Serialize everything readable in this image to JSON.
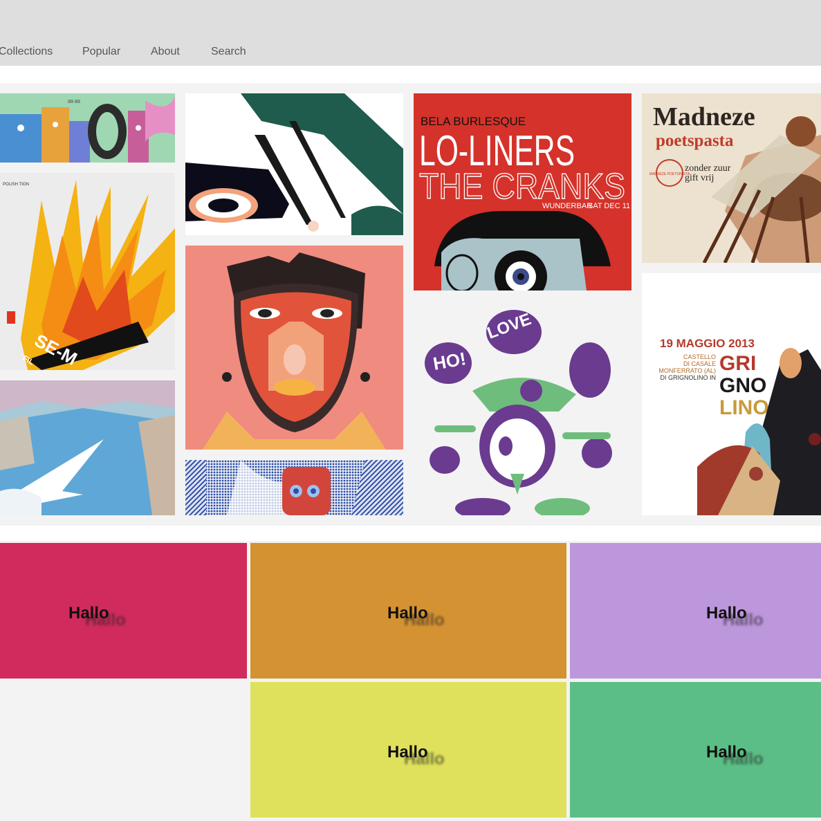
{
  "nav": {
    "items": [
      {
        "label": "Collections"
      },
      {
        "label": "Popular"
      },
      {
        "label": "About"
      },
      {
        "label": "Search"
      }
    ]
  },
  "gallery": {
    "posters": [
      {
        "text": "IIII-IIII"
      },
      {
        "text": "POLISH TION"
      },
      {
        "text": "SE-M"
      },
      {
        "text": "FIL"
      },
      {
        "text": "BELA BURLESQUE",
        "headline": "LO-LINERS",
        "subhead": "THE CRANKS",
        "venue": "WUNDERBAR",
        "date": "SAT DEC 11"
      },
      {
        "text": "HO!",
        "text2": "LOVE"
      },
      {
        "brand": "Madneze",
        "product": "poetspasta",
        "tagline1": "zonder zuur",
        "tagline2": "gift vrij",
        "seal": "MADNEZE POETSPASTA"
      },
      {
        "date": "19 MAGGIO 2013",
        "line1": "CASTELLO",
        "line2": "DI CASALE",
        "line3": "MONFERRATO (AL)",
        "line4": "DI GRIGNOLINO IN",
        "title1": "GRI",
        "title2": "GNO",
        "title3": "LINO"
      }
    ]
  },
  "blocks": [
    {
      "label": "Hallo",
      "color": "#d02b5c"
    },
    {
      "label": "Hallo",
      "color": "#d49232"
    },
    {
      "label": "Hallo",
      "color": "#bd97dc"
    },
    {
      "label": "Hallo",
      "color": "#dfe15c"
    },
    {
      "label": "Hallo",
      "color": "#5bbe86"
    }
  ]
}
